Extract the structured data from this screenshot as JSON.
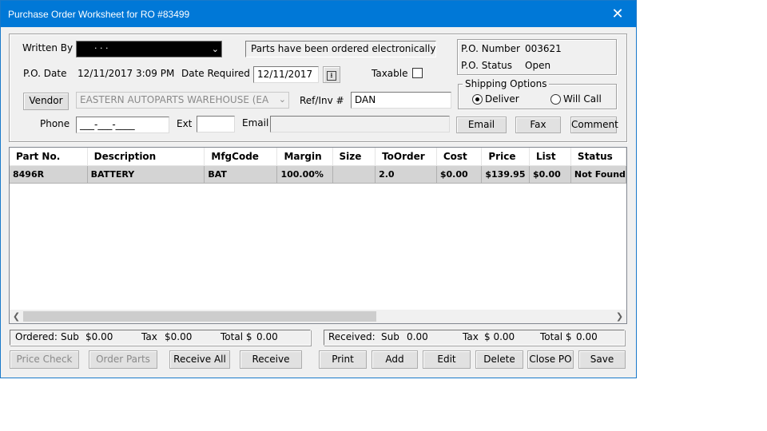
{
  "window": {
    "title": "Purchase Order Worksheet for RO #83499",
    "close_glyph": "✕"
  },
  "header": {
    "written_by_label": "Written By",
    "written_by_value": "·     ·  ·",
    "ordered_msg": "Parts have been ordered electronically",
    "po_number_label": "P.O. Number",
    "po_number_value": "003621",
    "po_status_label": "P.O. Status",
    "po_status_value": "Open",
    "po_date_label": "P.O. Date",
    "po_date_value": "12/11/2017 3:09 PM",
    "date_required_label": "Date Required",
    "date_required_value": "12/11/2017",
    "taxable_label": "Taxable",
    "shipping_label": "Shipping Options",
    "deliver_label": "Deliver",
    "willcall_label": "Will Call",
    "vendor_button": "Vendor",
    "vendor_value": "EASTERN AUTOPARTS WAREHOUSE (EA",
    "refinv_label": "Ref/Inv #",
    "refinv_value": "DAN",
    "phone_label": "Phone",
    "phone_value": "___-___-____",
    "ext_label": "Ext",
    "email_label": "Email",
    "email_button": "Email",
    "fax_button": "Fax",
    "comment_button": "Comment"
  },
  "grid": {
    "columns": [
      "Part No.",
      "Description",
      "MfgCode",
      "Margin",
      "Size",
      "ToOrder",
      "Cost",
      "Price",
      "List",
      "Status"
    ],
    "rows": [
      [
        "8496R",
        "BATTERY",
        "BAT",
        "100.00%",
        "",
        "2.0",
        "$0.00",
        "$139.95",
        "$0.00",
        "Not Found"
      ]
    ]
  },
  "totals": {
    "ordered": {
      "label": "Ordered:",
      "sub_label": "Sub",
      "sub": "$0.00",
      "tax_label": "Tax",
      "tax": "$0.00",
      "total_label": "Total $",
      "total": "0.00"
    },
    "received": {
      "label": "Received:",
      "sub_label": "Sub",
      "sub": "0.00",
      "tax_label": "Tax",
      "tax": "$ 0.00",
      "total_label": "Total $",
      "total": "0.00"
    }
  },
  "buttons": {
    "price_check": "Price Check",
    "order_parts": "Order Parts",
    "receive_all": "Receive All",
    "receive": "Receive",
    "print": "Print",
    "add": "Add",
    "edit": "Edit",
    "delete": "Delete",
    "close_po": "Close PO",
    "save": "Save"
  },
  "colors": {
    "titlebar": "#0078d7",
    "dialog_bg": "#f0f0f0",
    "selected_row": "#d4d4d4"
  }
}
